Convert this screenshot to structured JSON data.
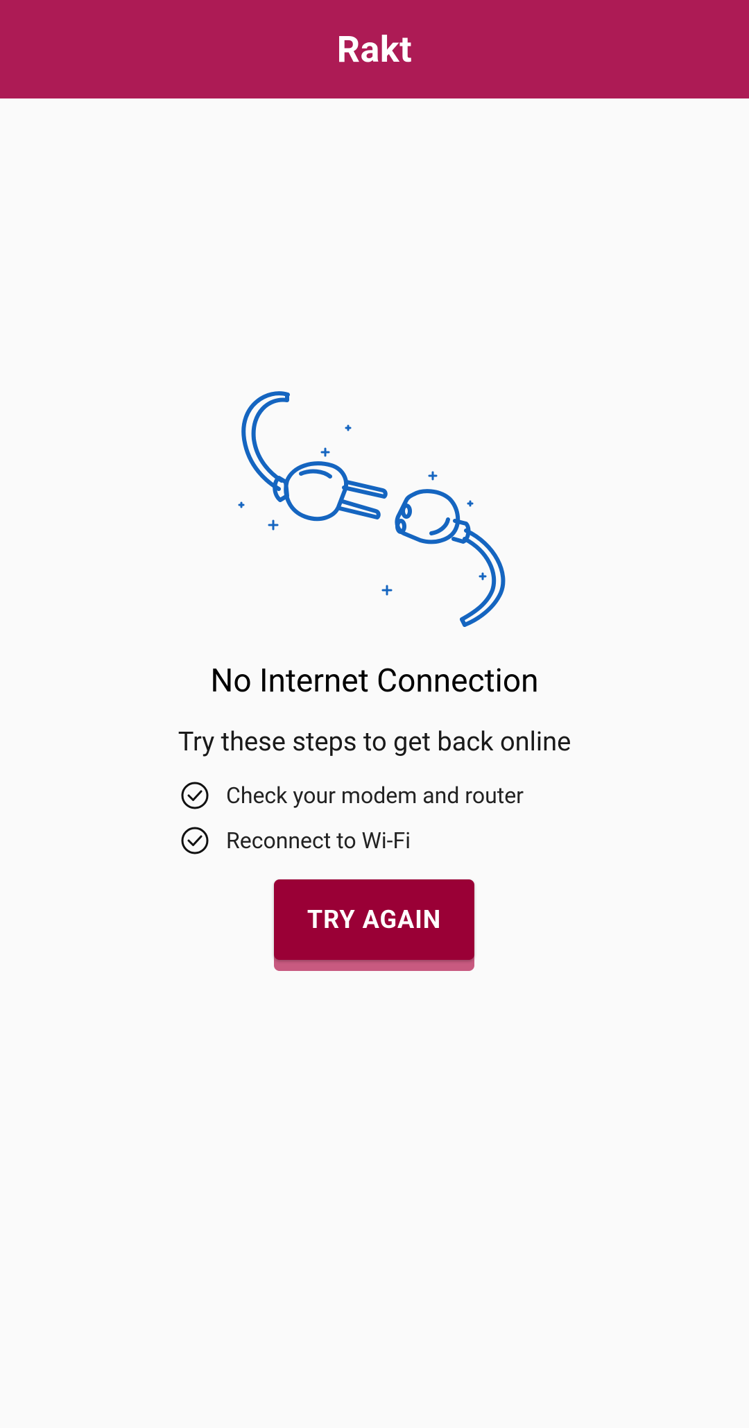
{
  "app_bar": {
    "title": "Rakt",
    "background_color": "#ad1b55"
  },
  "illustration": {
    "icon": "unplugged-cable-icon",
    "color": "#1565c0"
  },
  "message": {
    "headline": "No Internet Connection",
    "subhead": "Try these steps to get back online",
    "steps": [
      {
        "icon": "check-circle-icon",
        "label": "Check your modem and router"
      },
      {
        "icon": "check-circle-icon",
        "label": "Reconnect to Wi-Fi"
      }
    ]
  },
  "actions": {
    "try_again_label": "TRY AGAIN",
    "button_color": "#9a0036"
  }
}
